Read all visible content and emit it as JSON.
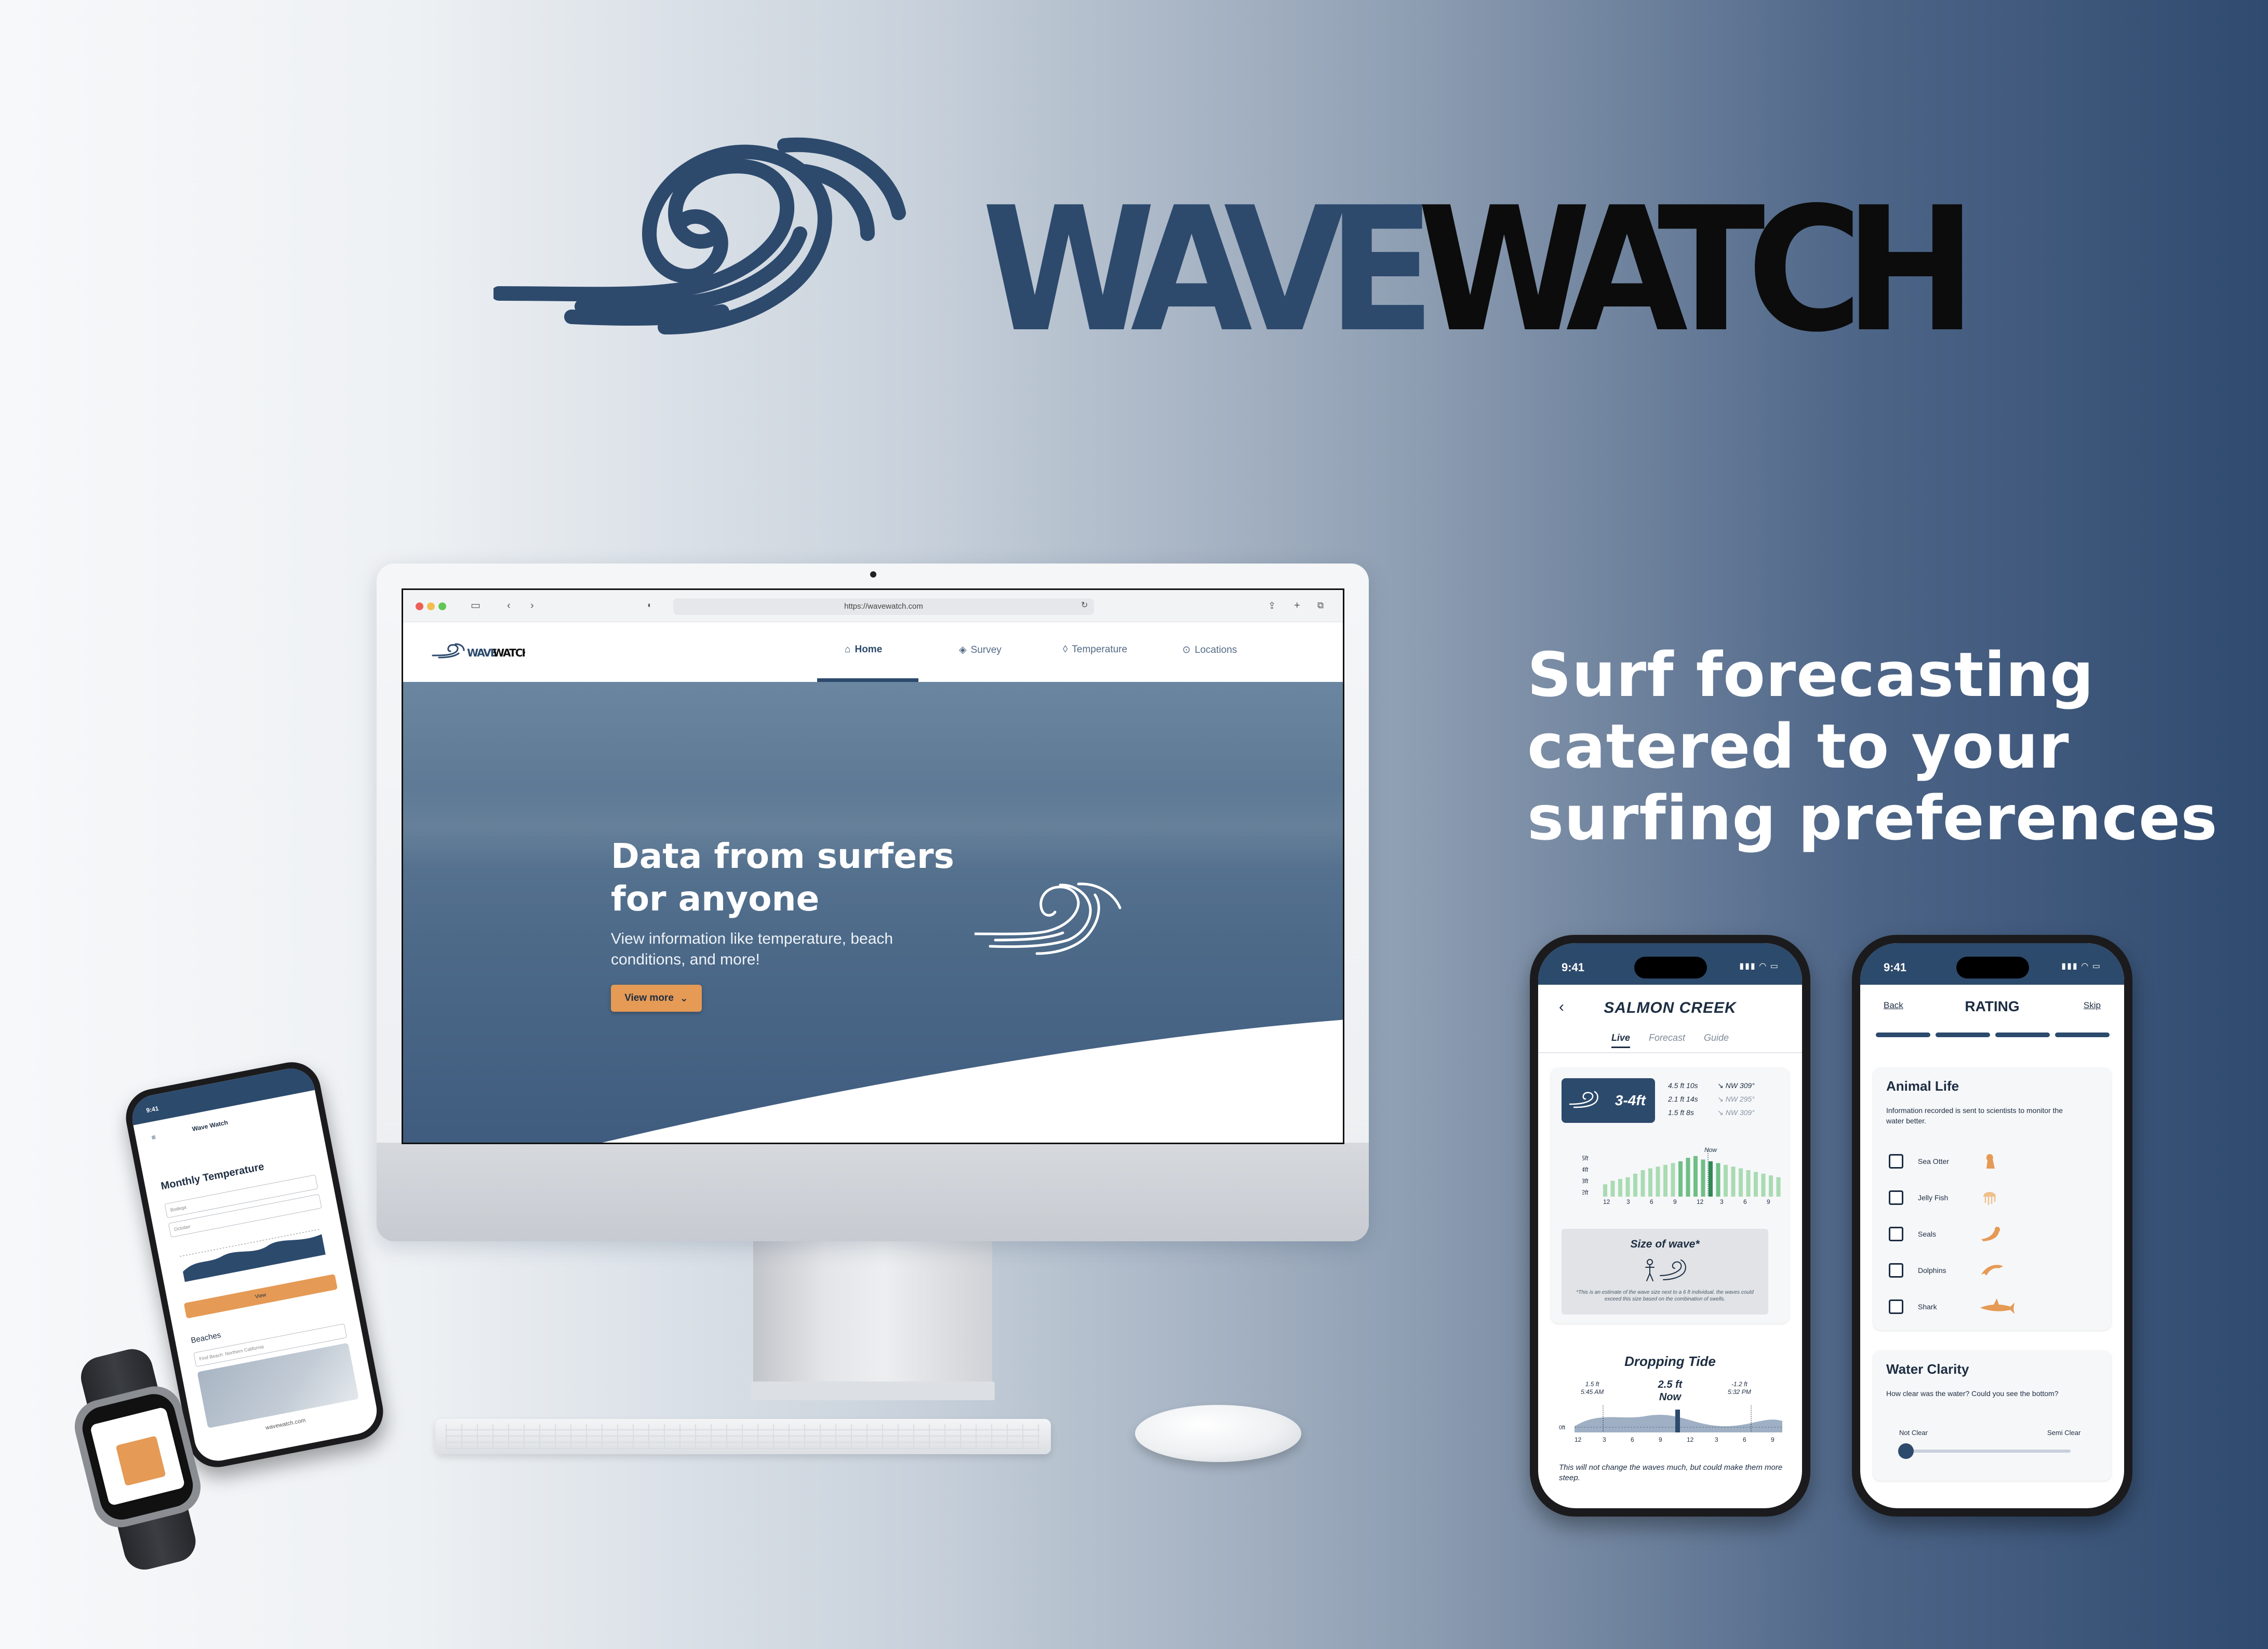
{
  "brand": {
    "word_part1": "WAVE",
    "word_part2": "WATCH",
    "color_primary": "#2d4a6d",
    "color_secondary": "#0c0c0c"
  },
  "tagline": [
    "Surf forecasting",
    "catered to your",
    "surfing preferences"
  ],
  "desktop": {
    "url": "https://wavewatch.com",
    "nav": [
      {
        "label": "Home",
        "icon": "home-icon",
        "active": true
      },
      {
        "label": "Survey",
        "icon": "layers-icon",
        "active": false
      },
      {
        "label": "Temperature",
        "icon": "droplet-icon",
        "active": false
      },
      {
        "label": "Locations",
        "icon": "map-pin-icon",
        "active": false
      }
    ],
    "hero": {
      "title": "Data from surfers for anyone",
      "subtitle": "View information like temperature, beach conditions, and more!",
      "button_label": "View more"
    }
  },
  "phone_forecast": {
    "time": "9:41",
    "title": "SALMON CREEK",
    "tabs": [
      "Live",
      "Forecast",
      "Guide"
    ],
    "active_tab": "Live",
    "wave_size": "3-4ft",
    "swells": [
      {
        "height": "4.5 ft",
        "period": "10s",
        "direction": "NW 309°"
      },
      {
        "height": "2.1 ft",
        "period": "14s",
        "direction": "NW 295°"
      },
      {
        "height": "1.5 ft",
        "period": "8s",
        "direction": "NW 309°"
      }
    ],
    "chart_now_label": "Now",
    "chart_y_labels": [
      "5ft",
      "4ft",
      "3ft",
      "2ft"
    ],
    "chart_x_labels": [
      "12",
      "3",
      "6",
      "9",
      "12",
      "3",
      "6",
      "9"
    ],
    "size_of_wave_title": "Size of wave*",
    "size_of_wave_note": "*This is an estimate of the wave size next to a 6 ft individual. the waves could exceed this size based on the combination of swells.",
    "tide_title": "Dropping Tide",
    "tide_now_value": "2.5 ft",
    "tide_now_label": "Now",
    "tide_left": {
      "value": "1.5 ft",
      "time": "5:45 AM"
    },
    "tide_right": {
      "value": "-1.2 ft",
      "time": "5:32 PM"
    },
    "tide_zero_label": "0ft",
    "tide_x_labels": [
      "12",
      "3",
      "6",
      "9",
      "12",
      "3",
      "6",
      "9"
    ],
    "tide_note": "This will not change the waves much, but could make them more steep."
  },
  "phone_rating": {
    "time": "9:41",
    "back_label": "Back",
    "title": "RATING",
    "skip_label": "Skip",
    "progress_steps": 4,
    "animal_section": {
      "title": "Animal Life",
      "description": "Information recorded is sent to scientists to monitor the water better.",
      "items": [
        {
          "label": "Sea Otter",
          "icon": "otter-icon"
        },
        {
          "label": "Jelly Fish",
          "icon": "jellyfish-icon"
        },
        {
          "label": "Seals",
          "icon": "seal-icon"
        },
        {
          "label": "Dolphins",
          "icon": "dolphin-icon"
        },
        {
          "label": "Shark",
          "icon": "shark-icon"
        }
      ]
    },
    "clarity_section": {
      "title": "Water Clarity",
      "description": "How clear was the water? Could you see the bottom?",
      "min_label": "Not Clear",
      "max_label": "Semi Clear",
      "level": 0
    },
    "accent": "#e59a55"
  },
  "phone_left": {
    "time": "9:41",
    "app_name": "Wave Watch",
    "title": "Monthly Temperature",
    "location_value": "Bodega",
    "month_value": "October",
    "button_label": "View",
    "beaches_title": "Beaches",
    "beach_search": "Find Beach: Northern California",
    "url": "wavewatch.com"
  }
}
